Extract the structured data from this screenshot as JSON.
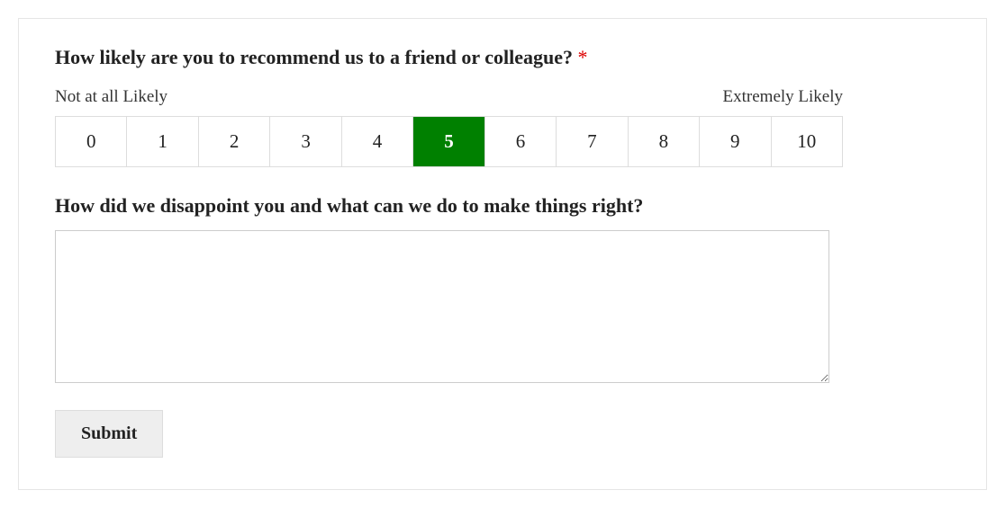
{
  "question": {
    "text": "How likely are you to recommend us to a friend or colleague?",
    "required_marker": "*"
  },
  "scale": {
    "low_label": "Not at all Likely",
    "high_label": "Extremely Likely",
    "options": [
      "0",
      "1",
      "2",
      "3",
      "4",
      "5",
      "6",
      "7",
      "8",
      "9",
      "10"
    ],
    "selected": "5"
  },
  "followup": {
    "label": "How did we disappoint you and what can we do to make things right?",
    "value": ""
  },
  "submit_label": "Submit"
}
